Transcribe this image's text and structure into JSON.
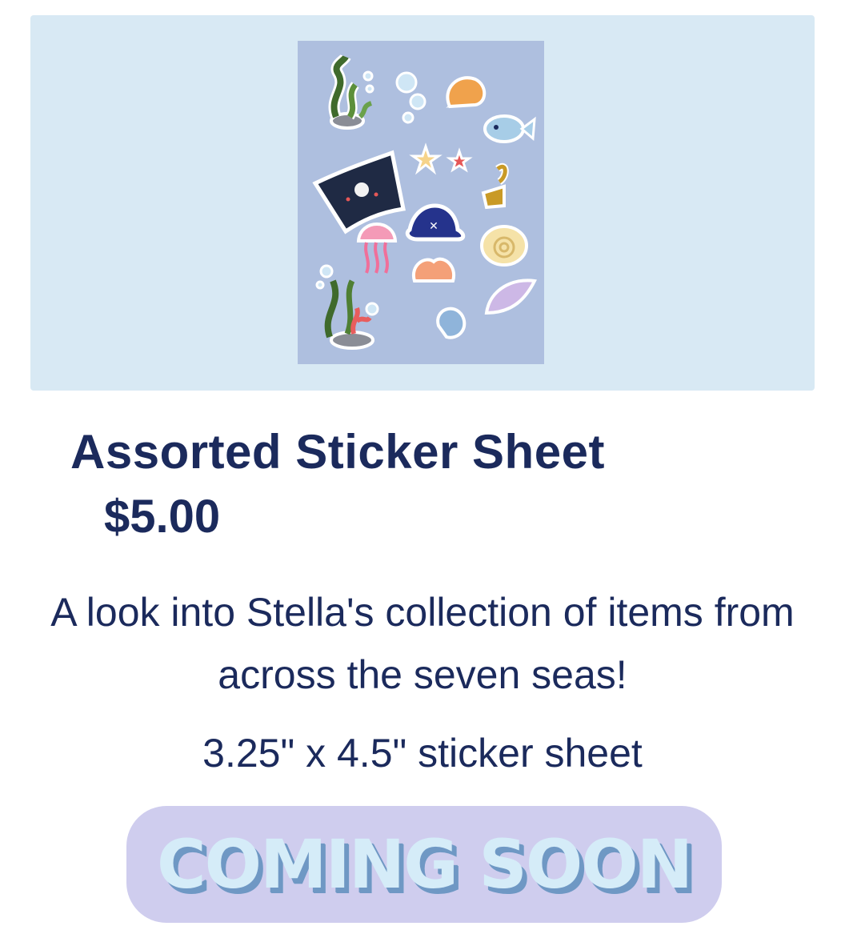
{
  "product": {
    "title": "Assorted Sticker Sheet",
    "price": "$5.00",
    "description": "A look into Stella's collection of items from across the seven seas!",
    "size": "3.25\" x 4.5\" sticker sheet",
    "button_label": "COMING SOON"
  },
  "image": {
    "stickers": [
      "seaweed-icon",
      "bubbles-icon",
      "scallop-shell-icon",
      "fish-icon",
      "starfish-icon",
      "pirate-flag-icon",
      "hook-icon",
      "pirate-hat-icon",
      "jellyfish-icon",
      "snail-shell-icon",
      "coral-icon",
      "conch-shell-icon"
    ]
  },
  "colors": {
    "text": "#1b2a5c",
    "hero_background": "#d8e9f4",
    "sheet_background": "#aebfdf",
    "button_background": "#cfcdee",
    "button_text": "#d5ecf8",
    "button_text_shadow": "#6f98c4"
  }
}
